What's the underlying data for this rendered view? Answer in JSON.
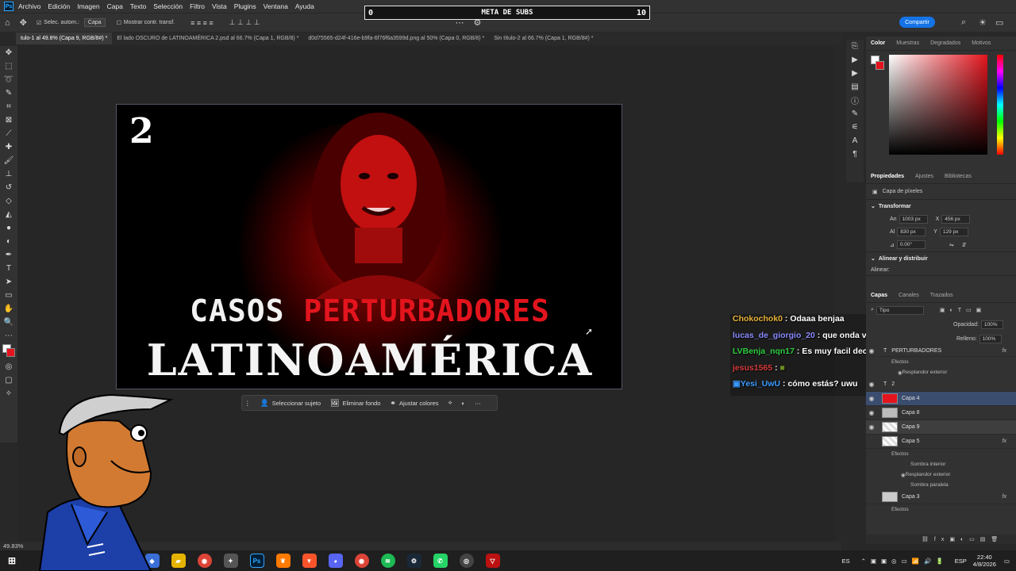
{
  "menubar": {
    "items": [
      "Archivo",
      "Edición",
      "Imagen",
      "Capa",
      "Texto",
      "Selección",
      "Filtro",
      "Vista",
      "Plugins",
      "Ventana",
      "Ayuda"
    ]
  },
  "options": {
    "auto_select_label": "Selec. autom.:",
    "auto_select_value": "Capa",
    "transform_label": "Mostrar contr. transf.",
    "share_label": "Compartir"
  },
  "stream": {
    "subs_left": "0",
    "subs_title": "META DE SUBS",
    "subs_right": "10"
  },
  "tabs": [
    "tulo-1 al 49.8% (Capa 9, RGB/8#) *",
    "El lado OSCURO de LATINOAMÉRICA 2.psd al 66.7% (Capa 1, RGB/8) *",
    "d0d75565-d24f-416e-b9fa-6f76f6a3599d.png al 50% (Capa 0, RGB/8) *",
    "Sin título-2 al 66.7% (Capa 1, RGB/8#) *"
  ],
  "canvas": {
    "number": "2",
    "line1_white": "CASOS ",
    "line1_red": "PERTURBADORES",
    "line2": "LATINOAMÉRICA"
  },
  "context_bar": {
    "select_subject": "Seleccionar sujeto",
    "remove_bg": "Eliminar fondo",
    "adjust_colors": "Ajustar colores"
  },
  "chat": [
    {
      "user": "Chokochok0",
      "msg": " : Odaaa benjaa",
      "color": "#e8b339"
    },
    {
      "user": "lucas_de_giorgio_20",
      "msg": " : que onda varion",
      "color": "#8a8aff"
    },
    {
      "user": "LVBenja_nqn17",
      "msg": " : Es muy facil decia Xdd",
      "color": "#2ecc40"
    },
    {
      "user": "jesus1565",
      "msg": " : ",
      "color": "#d63a3a"
    },
    {
      "user": "Yesi_UwU",
      "msg": " : cómo estás? uwu",
      "color": "#3b9cff"
    }
  ],
  "color_panel": {
    "tabs": [
      "Color",
      "Muestras",
      "Degradados",
      "Motivos"
    ]
  },
  "properties": {
    "tabs": [
      "Propiedades",
      "Ajustes",
      "Bibliotecas"
    ],
    "layer_type": "Capa de píxeles",
    "transform_title": "Transformar",
    "an_label": "An",
    "an": "1003 px",
    "x_label": "X",
    "x": "456 px",
    "al_label": "Al",
    "al": "830 px",
    "y_label": "Y",
    "y": "129 px",
    "angle": "0.00°",
    "align_title": "Alinear y distribuir",
    "align_label": "Alinear:"
  },
  "layers_panel": {
    "tabs": [
      "Capas",
      "Canales",
      "Trazados"
    ],
    "filter_label": "Tipo",
    "opacity_label": "Opacidad:",
    "opacity": "100%",
    "fill_label": "Relleno:",
    "fill": "100%",
    "layers": [
      {
        "name": "PERTURBADORES",
        "kind": "T"
      },
      {
        "name": "Efectos",
        "kind": "sub"
      },
      {
        "name": "Resplandor exterior",
        "kind": "sub"
      },
      {
        "name": "2",
        "kind": "T"
      },
      {
        "name": "Capa 4",
        "kind": "red"
      },
      {
        "name": "Capa 8",
        "kind": "img"
      },
      {
        "name": "Capa 9",
        "kind": "empty"
      },
      {
        "name": "Capa 5",
        "kind": "empty"
      },
      {
        "name": "Efectos",
        "kind": "sub"
      },
      {
        "name": "Sombra interior",
        "kind": "sub"
      },
      {
        "name": "Resplandor exterior",
        "kind": "sub"
      },
      {
        "name": "Sombra paralela",
        "kind": "sub"
      },
      {
        "name": "Capa 3",
        "kind": "img"
      },
      {
        "name": "Efectos",
        "kind": "sub"
      }
    ]
  },
  "status": {
    "zoom": "49.83%"
  },
  "taskbar": {
    "lang": "ES",
    "kbd": "ESP",
    "time": "22:40",
    "date": "4/8/2026"
  }
}
